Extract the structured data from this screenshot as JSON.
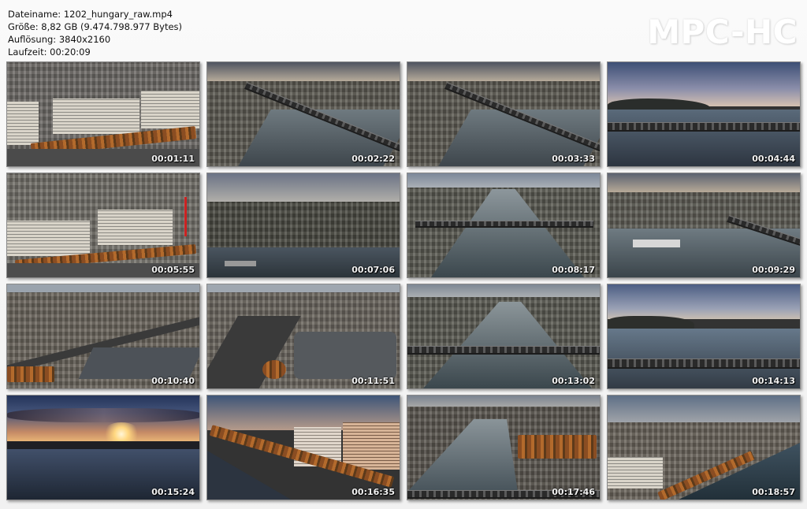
{
  "file_info": {
    "filename_line": "Dateiname: 1202_hungary_raw.mp4",
    "size_line": "Größe: 8,82 GB (9.474.798.977 Bytes)",
    "resolution_line": "Auflösung: 3840x2160",
    "duration_line": "Laufzeit: 00:20:09"
  },
  "logo_text": "MPC-HC",
  "thumbnails": [
    {
      "time": "00:01:11",
      "scene": "city-buildings"
    },
    {
      "time": "00:02:22",
      "scene": "river-bridge-dusk"
    },
    {
      "time": "00:03:33",
      "scene": "river-bridge-dusk"
    },
    {
      "time": "00:04:44",
      "scene": "river-bridge-evening"
    },
    {
      "time": "00:05:55",
      "scene": "city-buildings"
    },
    {
      "time": "00:07:06",
      "scene": "river-bank-cloudy"
    },
    {
      "time": "00:08:17",
      "scene": "river-bridge-aerial"
    },
    {
      "time": "00:09:29",
      "scene": "river-boat"
    },
    {
      "time": "00:10:40",
      "scene": "city-junction"
    },
    {
      "time": "00:11:51",
      "scene": "city-square"
    },
    {
      "time": "00:13:02",
      "scene": "river-bridge-aerial"
    },
    {
      "time": "00:14:13",
      "scene": "river-bridge-wide"
    },
    {
      "time": "00:15:24",
      "scene": "sunset-water"
    },
    {
      "time": "00:16:35",
      "scene": "riverside-buildings"
    },
    {
      "time": "00:17:46",
      "scene": "river-bend"
    },
    {
      "time": "00:18:57",
      "scene": "riverside-buildings-wide"
    }
  ],
  "colors": {
    "background": "#f5f5f5",
    "text": "#111111",
    "logo": "#ffffff"
  }
}
